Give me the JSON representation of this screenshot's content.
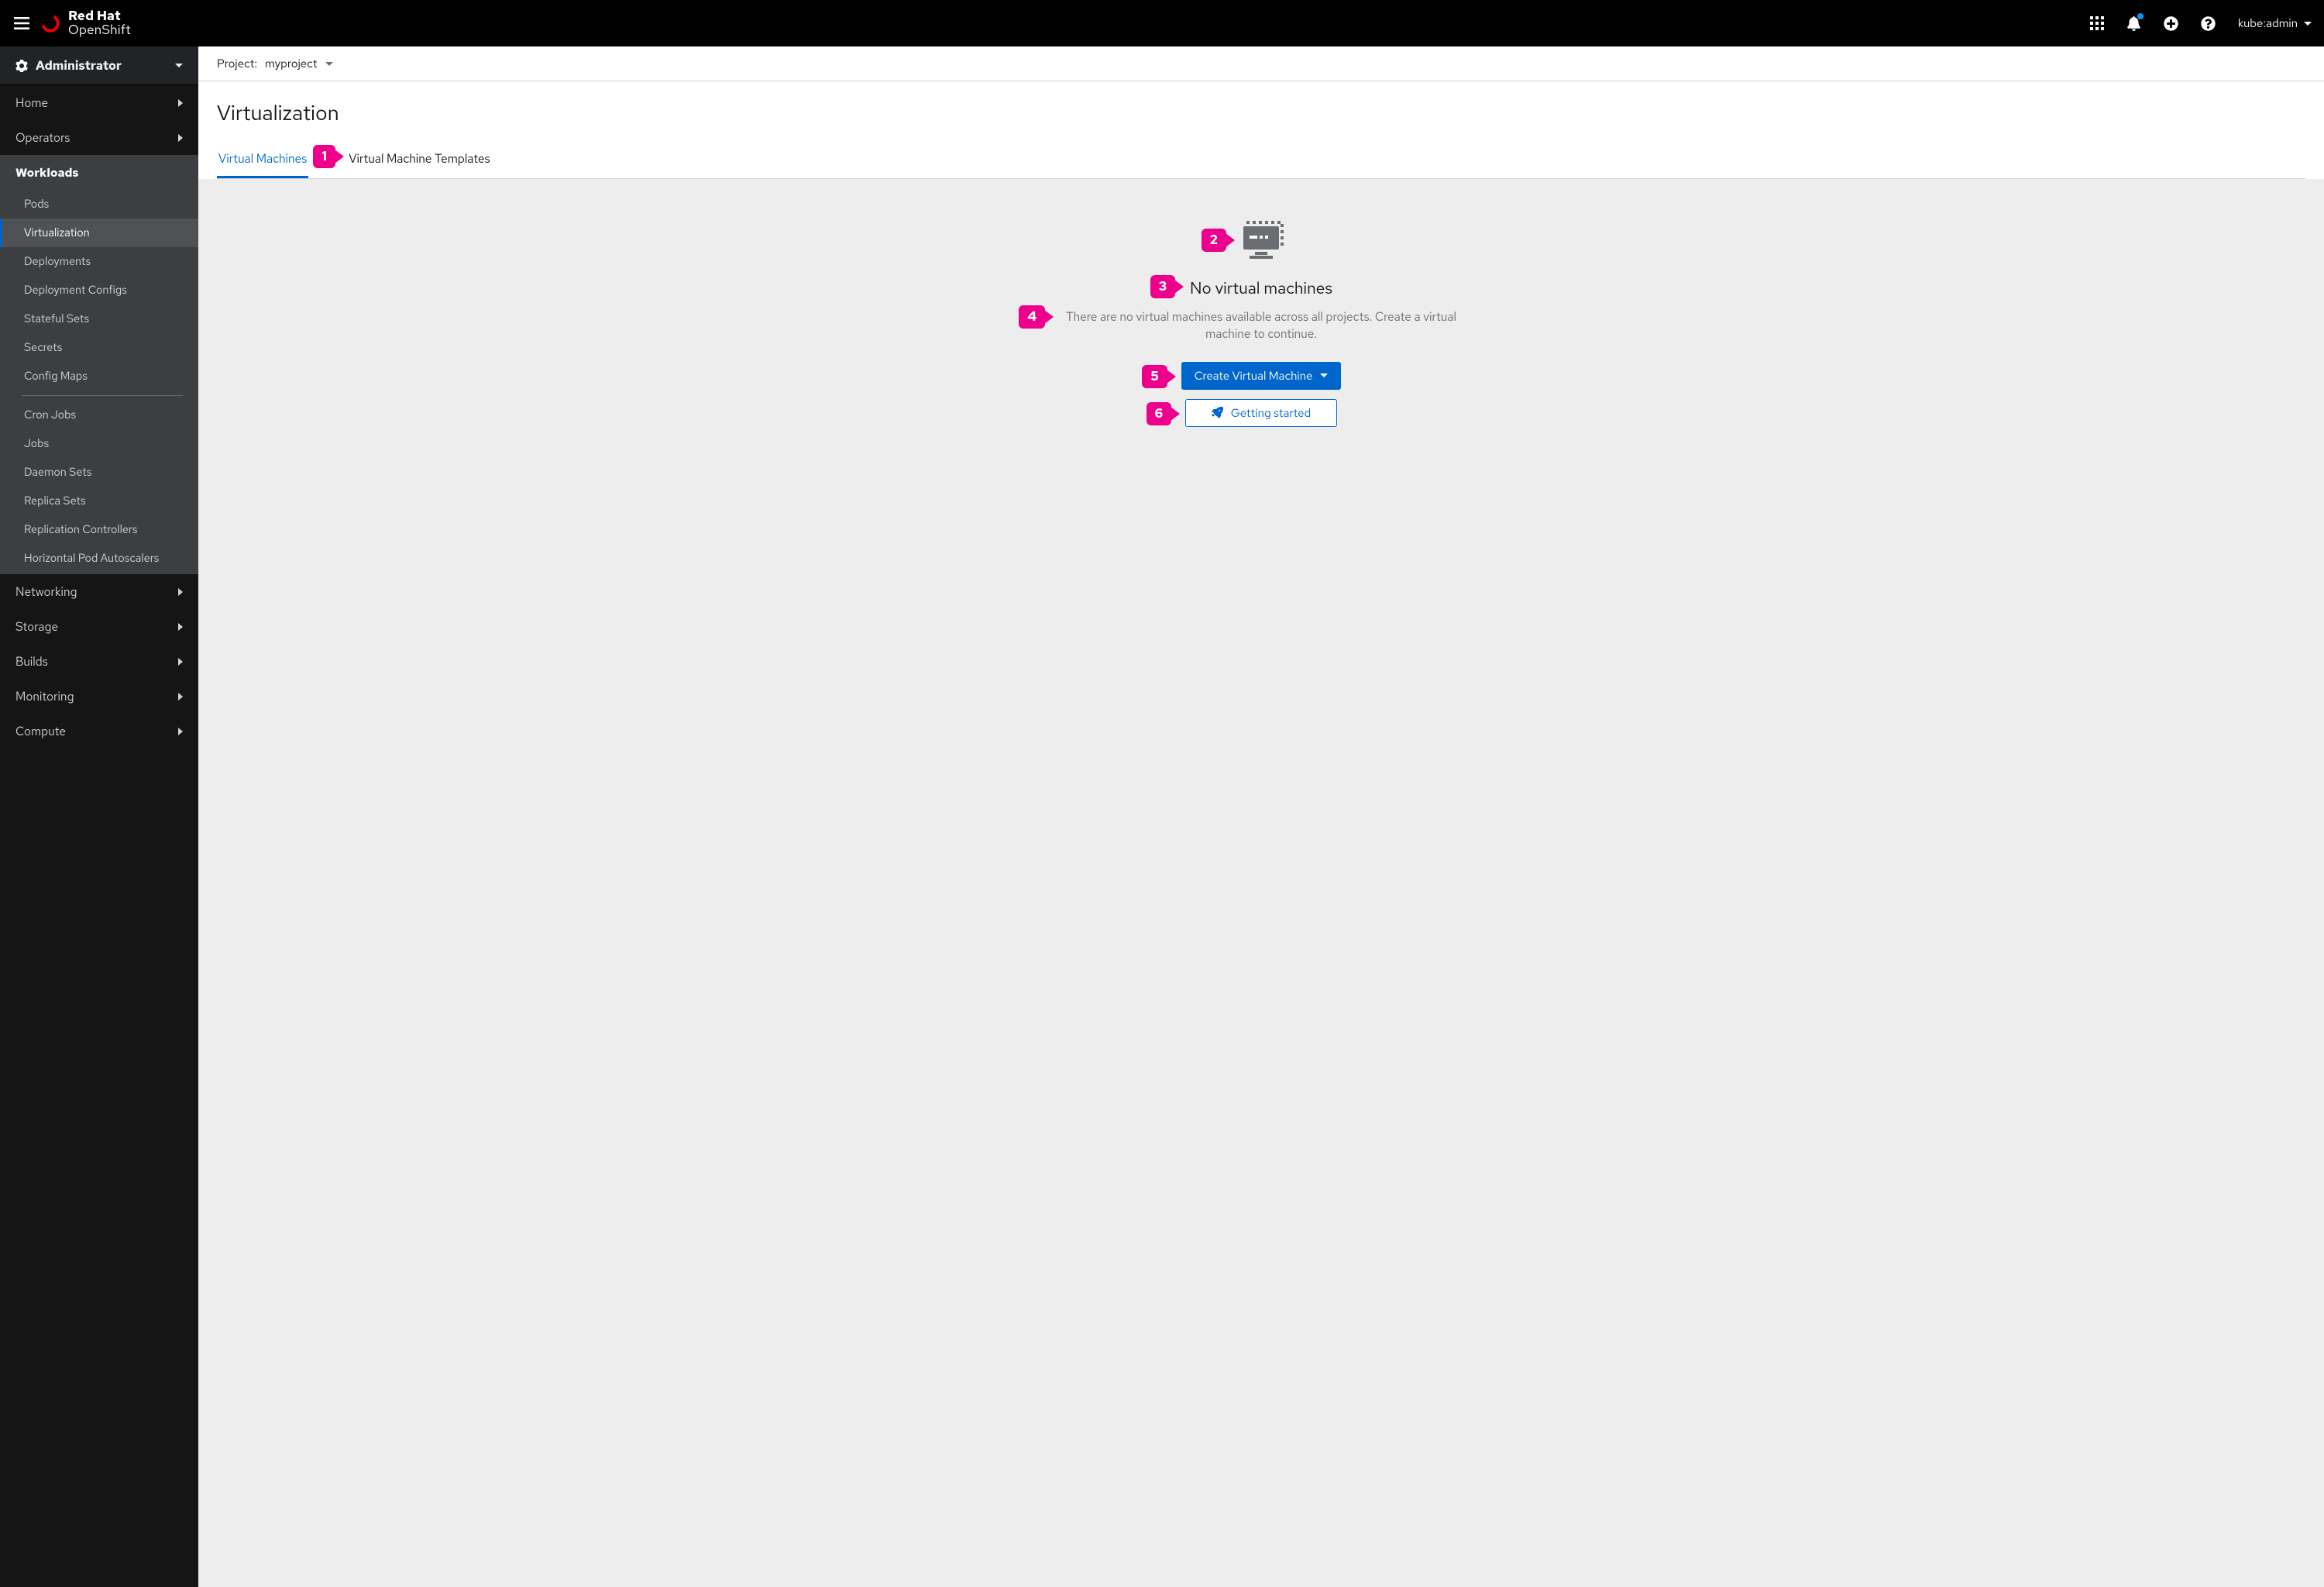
{
  "header": {
    "brand_line1_strong": "Red Hat",
    "brand_line2": "OpenShift",
    "user": "kube:admin"
  },
  "perspective": {
    "label": "Administrator"
  },
  "sidebar": {
    "home": "Home",
    "operators": "Operators",
    "workloads": {
      "label": "Workloads",
      "items": {
        "pods": "Pods",
        "virtualization": "Virtualization",
        "deployments": "Deployments",
        "deployment_configs": "Deployment Configs",
        "stateful_sets": "Stateful Sets",
        "secrets": "Secrets",
        "config_maps": "Config Maps",
        "cron_jobs": "Cron Jobs",
        "jobs": "Jobs",
        "daemon_sets": "Daemon Sets",
        "replica_sets": "Replica Sets",
        "replication_controllers": "Replication Controllers",
        "hpas": "Horizontal Pod Autoscalers"
      }
    },
    "networking": "Networking",
    "storage": "Storage",
    "builds": "Builds",
    "monitoring": "Monitoring",
    "compute": "Compute"
  },
  "projectBar": {
    "prefix": "Project:",
    "value": "myproject"
  },
  "page": {
    "title": "Virtualization",
    "tabs": {
      "vms": "Virtual Machines",
      "templates": "Virtual Machine Templates"
    }
  },
  "empty": {
    "heading": "No virtual machines",
    "body": "There are no virtual machines available across all projects. Create a virtual machine to continue.",
    "cta_primary": "Create Virtual Machine",
    "cta_secondary": "Getting started"
  },
  "callouts": {
    "c1": "1",
    "c2": "2",
    "c3": "3",
    "c4": "4",
    "c5": "5",
    "c6": "6"
  }
}
